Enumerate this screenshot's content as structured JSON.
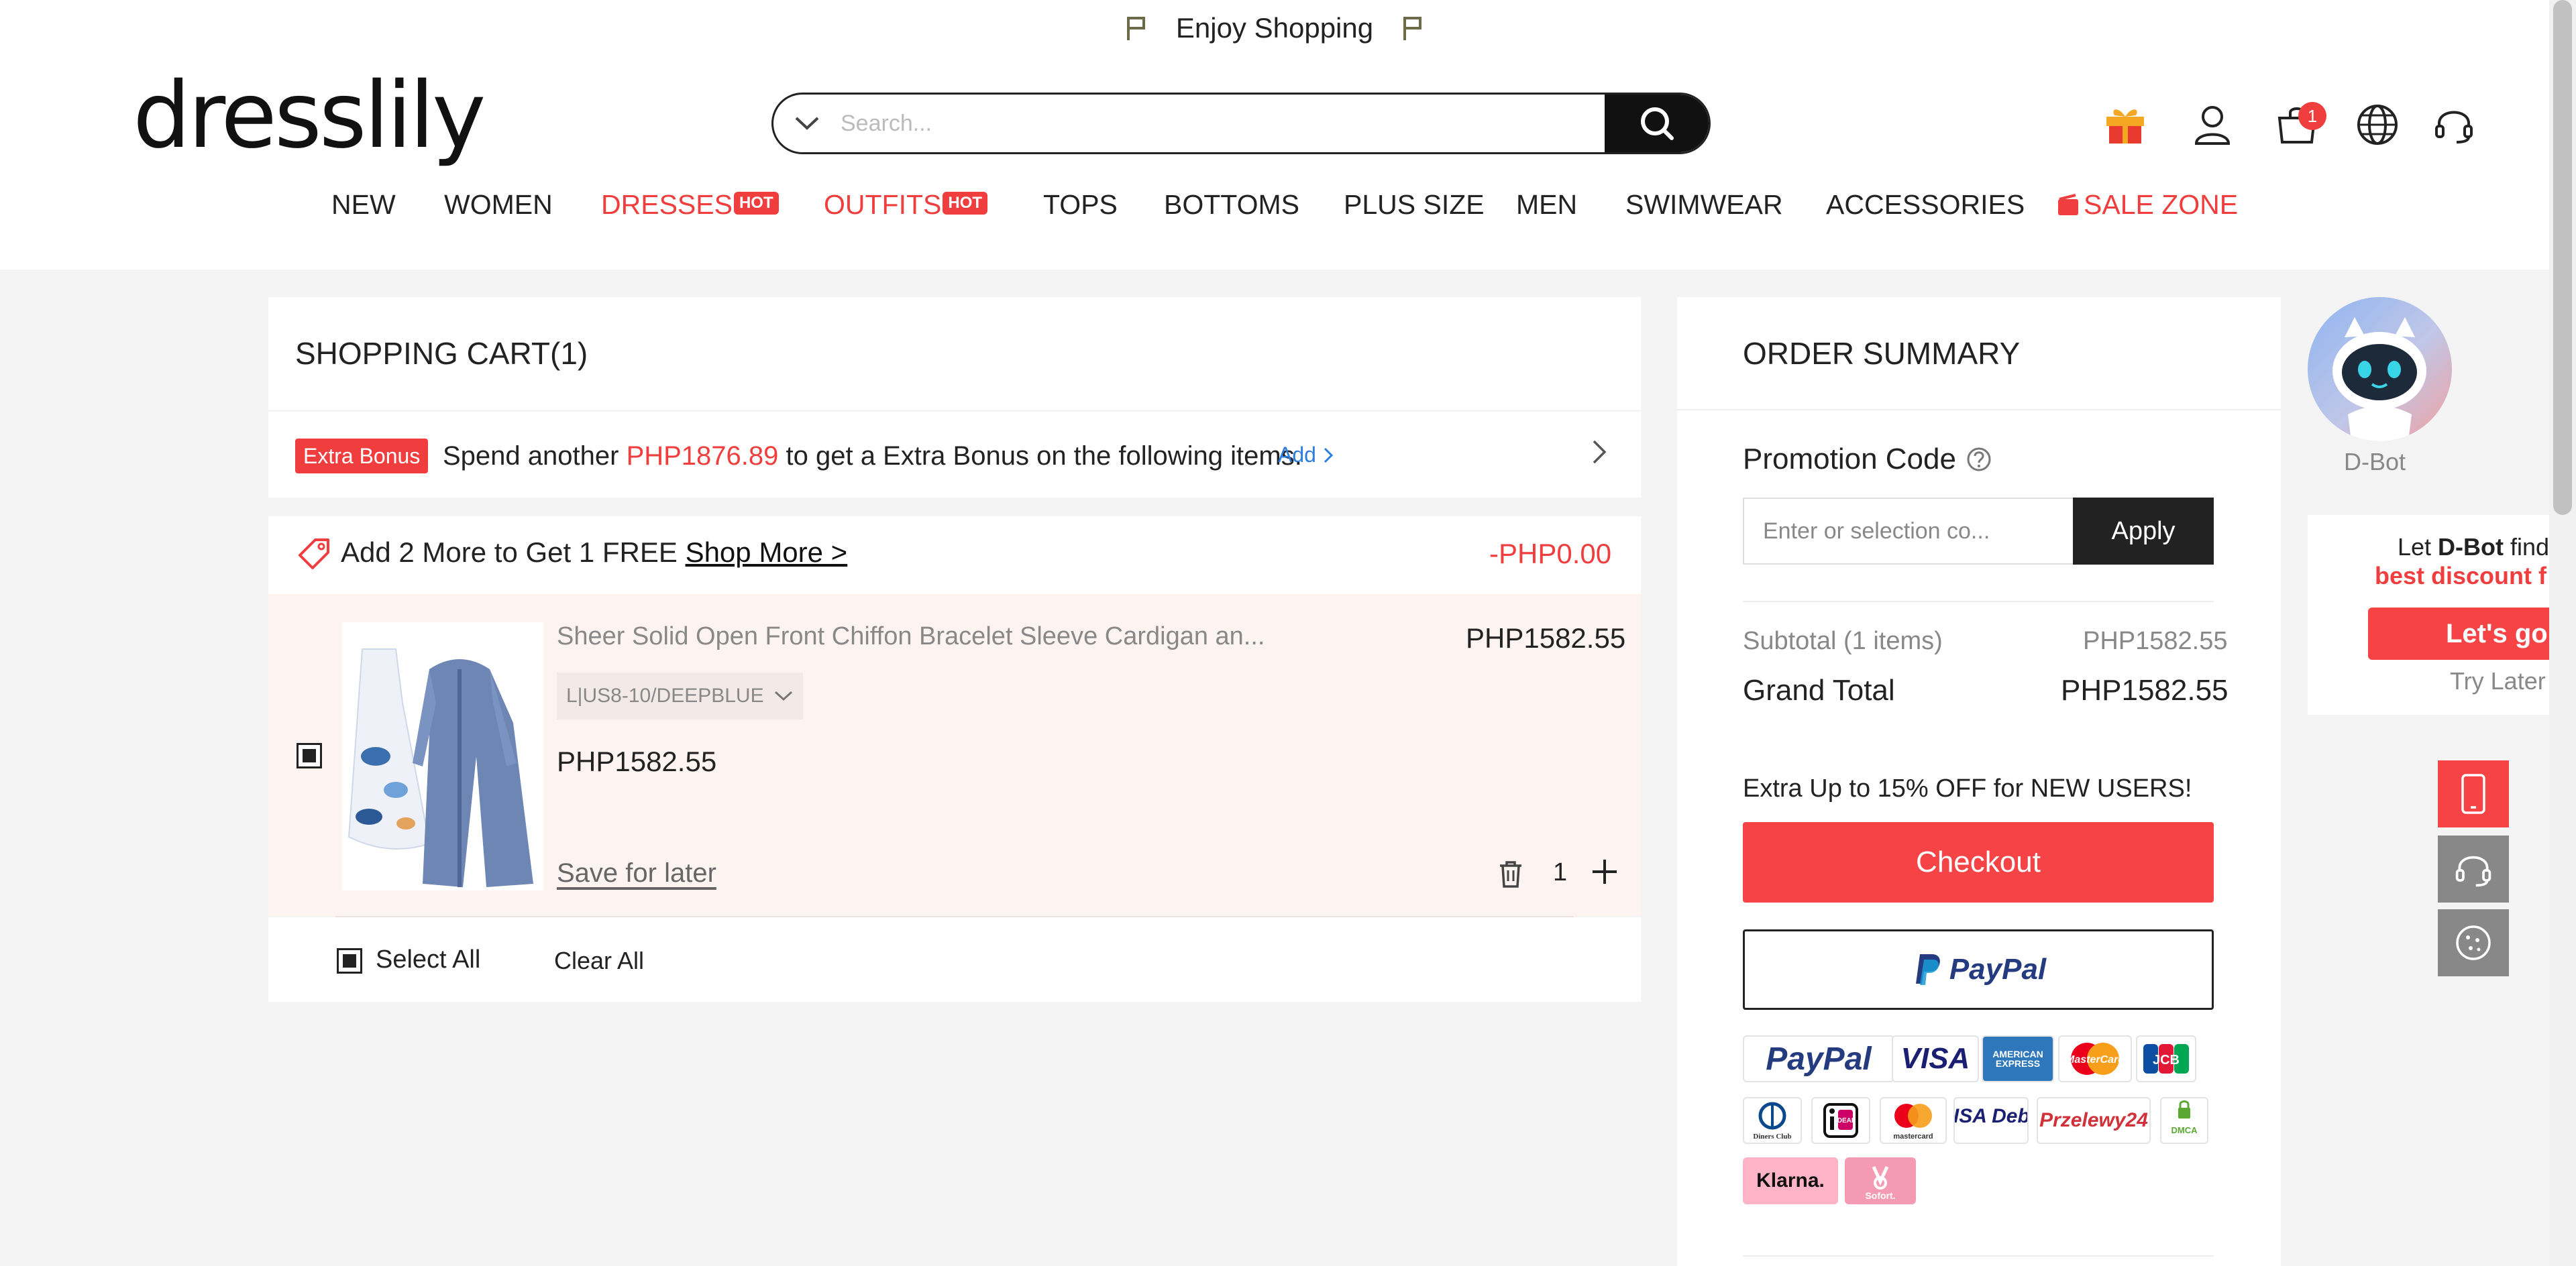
{
  "announcement": {
    "text": "Enjoy Shopping"
  },
  "header": {
    "logo": "dresslily",
    "search": {
      "placeholder": "Search..."
    },
    "cart_count": "1"
  },
  "nav": {
    "items": [
      {
        "label": "NEW"
      },
      {
        "label": "WOMEN"
      },
      {
        "label": "DRESSES",
        "badge": "HOT"
      },
      {
        "label": "OUTFITS",
        "badge": "HOT"
      },
      {
        "label": "TOPS"
      },
      {
        "label": "BOTTOMS"
      },
      {
        "label": "PLUS SIZE"
      },
      {
        "label": "MEN"
      },
      {
        "label": "SWIMWEAR"
      },
      {
        "label": "ACCESSORIES"
      },
      {
        "label": "SALE ZONE"
      }
    ]
  },
  "cart": {
    "title": "SHOPPING CART(1)",
    "bonus": {
      "tag": "Extra Bonus",
      "text_before": "Spend another ",
      "amount": "PHP1876.89",
      "text_after": " to get a Extra Bonus on the following items.",
      "add_label": "Add"
    },
    "promo": {
      "text": "Add 2 More to Get 1 FREE ",
      "link": "Shop More >",
      "discount": "-PHP0.00"
    },
    "item": {
      "name": "Sheer Solid Open Front Chiffon Bracelet Sleeve Cardigan an...",
      "variant": "L|US8-10/DEEPBLUE",
      "price": "PHP1582.55",
      "sale_price": "PHP1582.55",
      "save_later": "Save for later",
      "quantity": "1"
    },
    "select_all": "Select All",
    "clear_all": "Clear All"
  },
  "summary": {
    "title": "ORDER SUMMARY",
    "promo_label": "Promotion Code",
    "promo_placeholder": "Enter or selection co...",
    "apply": "Apply",
    "subtotal_label": "Subtotal (1 items)",
    "subtotal_value": "PHP1582.55",
    "grand_label": "Grand Total",
    "grand_value": "PHP1582.55",
    "new_users": "Extra Up to 15% OFF for NEW USERS!",
    "checkout": "Checkout",
    "paypal_label": "PayPal",
    "payment_methods": [
      "PayPal",
      "VISA",
      "AMERICAN EXPRESS",
      "MasterCard",
      "JCB",
      "Diners Club",
      "iDEAL",
      "mastercard",
      "VISA Debit",
      "Przelewy24",
      "DMCA",
      "Klarna.",
      "Sofort."
    ]
  },
  "dbot": {
    "name": "D-Bot",
    "line1_prefix": "Let ",
    "line1_bold": "D-Bot",
    "line1_suffix": " find",
    "line2": "best discount f",
    "go": "Let's go",
    "later": "Try Later"
  },
  "colors": {
    "accent": "#f03e3e",
    "checkout": "#f64446",
    "link": "#2b7de0",
    "dark": "#222222"
  }
}
